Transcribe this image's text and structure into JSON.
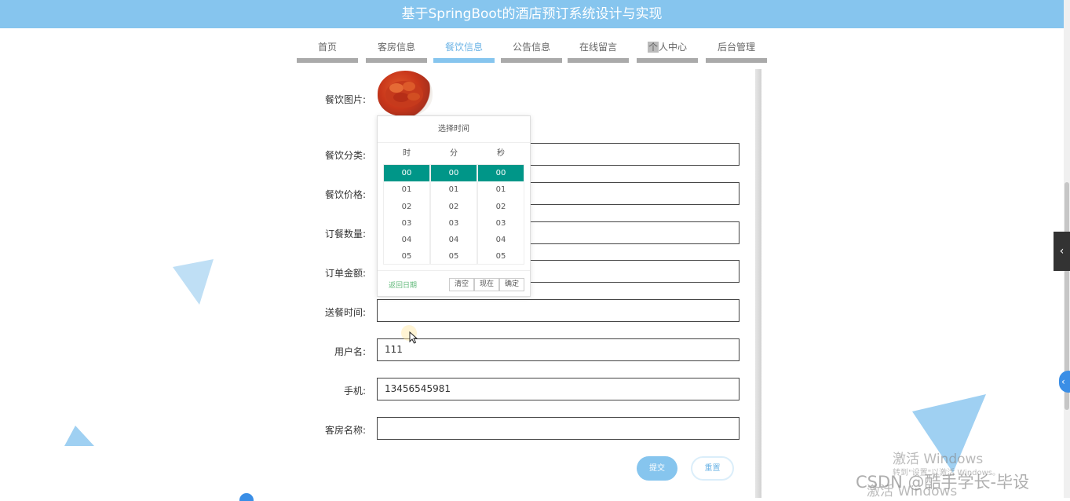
{
  "header": {
    "title": "基于SpringBoot的酒店预订系统设计与实现"
  },
  "nav": {
    "items": [
      {
        "label": "首页"
      },
      {
        "label": "客房信息"
      },
      {
        "label": "餐饮信息"
      },
      {
        "label": "公告信息"
      },
      {
        "label": "在线留言"
      },
      {
        "label": "个人中心",
        "mark": "个",
        "rest": "人中心"
      },
      {
        "label": "后台管理"
      }
    ],
    "active_index": 2
  },
  "form": {
    "image_label": "餐饮图片:",
    "fields": [
      {
        "label": "餐饮分类:",
        "value": ""
      },
      {
        "label": "餐饮价格:",
        "value": ""
      },
      {
        "label": "订餐数量:",
        "value": ""
      },
      {
        "label": "订单金额:",
        "value": ""
      },
      {
        "label": "送餐时间:",
        "value": ""
      },
      {
        "label": "用户名:",
        "value": "111"
      },
      {
        "label": "手机:",
        "value": "13456545981"
      },
      {
        "label": "客房名称:",
        "value": ""
      }
    ],
    "submit_label": "提交",
    "reset_label": "重置"
  },
  "time_picker": {
    "title": "选择时间",
    "columns": [
      {
        "header": "时",
        "values": [
          "00",
          "01",
          "02",
          "03",
          "04",
          "05"
        ]
      },
      {
        "header": "分",
        "values": [
          "00",
          "01",
          "02",
          "03",
          "04",
          "05"
        ]
      },
      {
        "header": "秒",
        "values": [
          "00",
          "01",
          "02",
          "03",
          "04",
          "05"
        ]
      }
    ],
    "selected_value": "00",
    "back_label": "返回日期",
    "clear_label": "清空",
    "now_label": "现在",
    "confirm_label": "确定"
  },
  "side": {
    "toggle_icon": "‹",
    "handle_icon": "‹"
  },
  "watermark": {
    "activate_title": "激活 Windows",
    "activate_subtitle": "转到\"设置\"以激活 Windows。",
    "csdn": "CSDN @酷手学长-毕设",
    "activate_dup": "激活 Windows"
  },
  "colors": {
    "header": "#86c5ee",
    "accent": "#009688",
    "link": "#5fb878"
  }
}
